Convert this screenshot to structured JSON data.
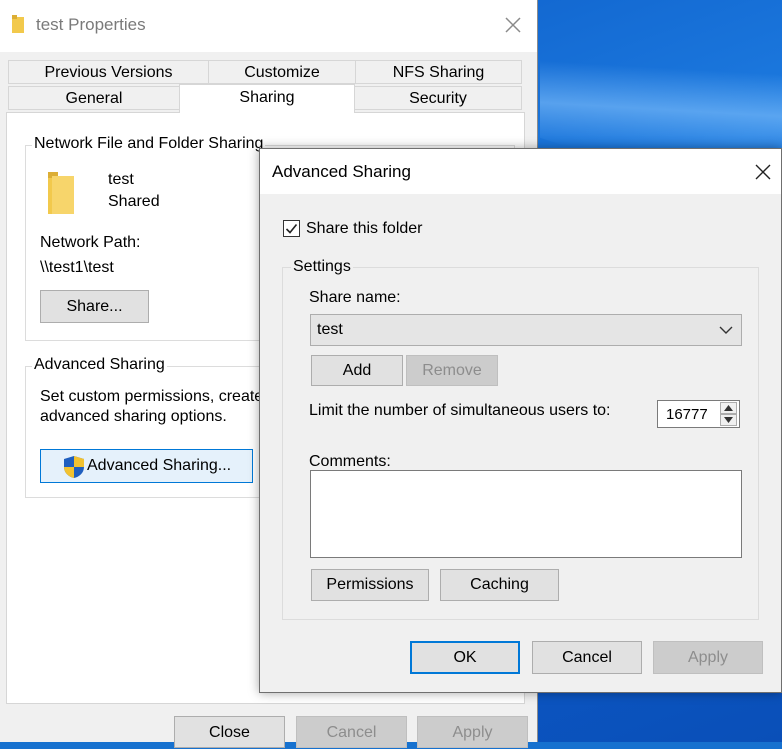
{
  "properties": {
    "title": "test Properties",
    "tabs_row1": [
      "Previous Versions",
      "Customize",
      "NFS Sharing"
    ],
    "tabs_row2": [
      "General",
      "Sharing",
      "Security"
    ],
    "network_sharing": {
      "group_label": "Network File and Folder Sharing",
      "folder_name": "test",
      "status": "Shared",
      "network_path_label": "Network Path:",
      "network_path": "\\\\test1\\test",
      "share_button": "Share..."
    },
    "advanced": {
      "group_label": "Advanced Sharing",
      "desc_line1": "Set custom permissions, create",
      "desc_line2": "advanced sharing options.",
      "button": "Advanced Sharing..."
    },
    "footer": {
      "close": "Close",
      "cancel": "Cancel",
      "apply": "Apply"
    }
  },
  "advanced_sharing": {
    "title": "Advanced Sharing",
    "share_this_folder_label": "Share this folder",
    "share_this_folder_checked": true,
    "settings_label": "Settings",
    "share_name_label": "Share name:",
    "share_name_value": "test",
    "add": "Add",
    "remove": "Remove",
    "limit_label": "Limit the number of simultaneous users to:",
    "limit_value": "16777",
    "comments_label": "Comments:",
    "comments_value": "",
    "permissions": "Permissions",
    "caching": "Caching",
    "ok": "OK",
    "cancel": "Cancel",
    "apply": "Apply"
  },
  "colors": {
    "accent": "#0078d7",
    "folder_yellow": "#f2c94c",
    "desktop_blue": "#1671cf"
  }
}
